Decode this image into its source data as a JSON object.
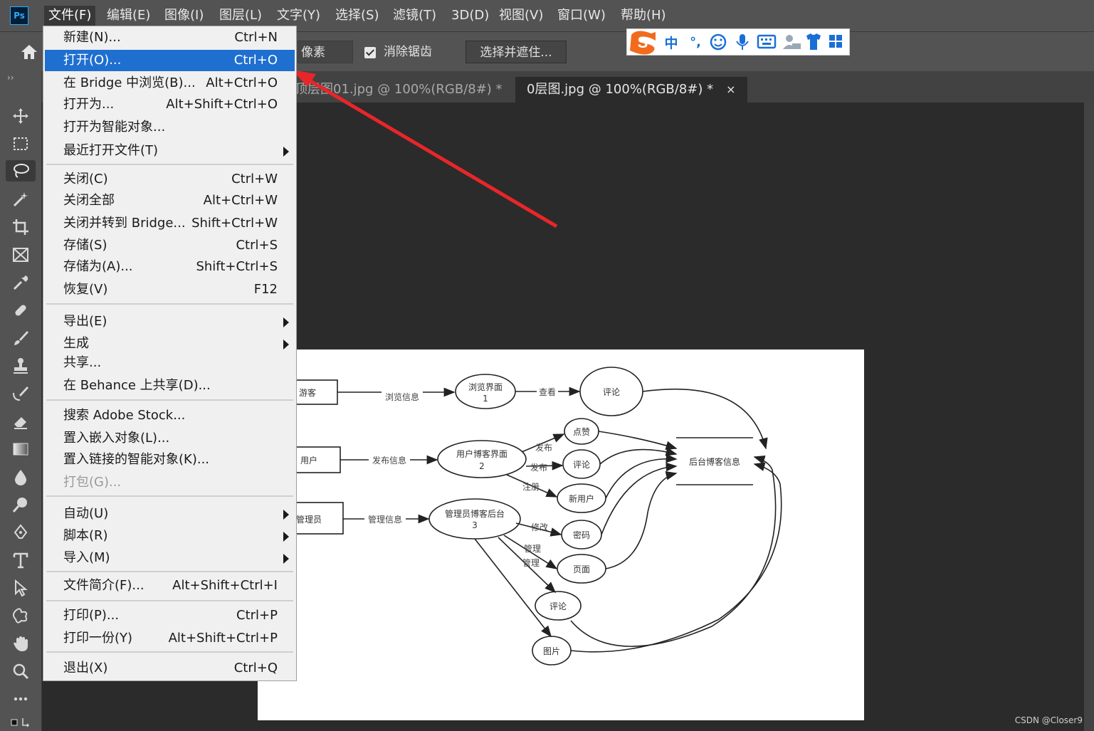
{
  "app": {
    "logo": "Ps"
  },
  "menubar": [
    "文件(F)",
    "编辑(E)",
    "图像(I)",
    "图层(L)",
    "文字(Y)",
    "选择(S)",
    "滤镜(T)",
    "3D(D)",
    "视图(V)",
    "窗口(W)",
    "帮助(H)"
  ],
  "options": {
    "pixel_unit": "像素",
    "antialias_label": "消除锯齿",
    "select_mask_button": "选择并遮住..."
  },
  "tabs": [
    {
      "label": "顶层图01.jpg @ 100%(RGB/8#) *",
      "close": "×",
      "active": false
    },
    {
      "label": "0层图.jpg @ 100%(RGB/8#) *",
      "close": "×",
      "active": true
    }
  ],
  "ime": {
    "items": [
      "中",
      "°,"
    ]
  },
  "file_menu": {
    "items": [
      {
        "label": "新建(N)...",
        "shortcut": "Ctrl+N"
      },
      {
        "label": "打开(O)...",
        "shortcut": "Ctrl+O",
        "highlighted": true
      },
      {
        "label": "在 Bridge 中浏览(B)...",
        "shortcut": "Alt+Ctrl+O"
      },
      {
        "label": "打开为...",
        "shortcut": "Alt+Shift+Ctrl+O"
      },
      {
        "label": "打开为智能对象..."
      },
      {
        "label": "最近打开文件(T)",
        "submenu": true
      },
      {
        "label": "关闭(C)",
        "shortcut": "Ctrl+W"
      },
      {
        "label": "关闭全部",
        "shortcut": "Alt+Ctrl+W"
      },
      {
        "label": "关闭并转到 Bridge...",
        "shortcut": "Shift+Ctrl+W"
      },
      {
        "label": "存储(S)",
        "shortcut": "Ctrl+S"
      },
      {
        "label": "存储为(A)...",
        "shortcut": "Shift+Ctrl+S"
      },
      {
        "label": "恢复(V)",
        "shortcut": "F12"
      },
      {
        "label": "导出(E)",
        "submenu": true
      },
      {
        "label": "生成",
        "submenu": true
      },
      {
        "label": "共享..."
      },
      {
        "label": "在 Behance 上共享(D)..."
      },
      {
        "label": "搜索 Adobe Stock..."
      },
      {
        "label": "置入嵌入对象(L)..."
      },
      {
        "label": "置入链接的智能对象(K)..."
      },
      {
        "label": "打包(G)...",
        "disabled": true
      },
      {
        "label": "自动(U)",
        "submenu": true
      },
      {
        "label": "脚本(R)",
        "submenu": true
      },
      {
        "label": "导入(M)",
        "submenu": true
      },
      {
        "label": "文件简介(F)...",
        "shortcut": "Alt+Shift+Ctrl+I"
      },
      {
        "label": "打印(P)...",
        "shortcut": "Ctrl+P"
      },
      {
        "label": "打印一份(Y)",
        "shortcut": "Alt+Shift+Ctrl+P"
      },
      {
        "label": "退出(X)",
        "shortcut": "Ctrl+Q"
      }
    ]
  },
  "diagram": {
    "nodes": {
      "visitor": "游客",
      "user": "用户",
      "admin": "管理员",
      "browse_ui": "浏览界面",
      "browse_num": "1",
      "user_blog_ui": "用户博客界面",
      "user_blog_num": "2",
      "admin_backend": "管理员博客后台",
      "admin_num": "3",
      "comment_top": "评论",
      "like": "点赞",
      "comment_mid": "评论",
      "new_user": "新用户",
      "password": "密码",
      "page": "页面",
      "comment_bottom": "评论",
      "image": "图片",
      "store": "后台博客信息"
    },
    "edges": {
      "browse_info": "浏览信息",
      "view": "查看",
      "publish_info": "发布信息",
      "publish1": "发布",
      "publish2": "发布",
      "register": "注册",
      "manage_info": "管理信息",
      "modify": "修改",
      "manage1": "管理",
      "manage2": "管理"
    }
  },
  "watermark": "CSDN @Closer9",
  "colors": {
    "highlight": "#1e6fd0",
    "arrow": "#e8262a",
    "ime_brand": "#f26b1d"
  }
}
